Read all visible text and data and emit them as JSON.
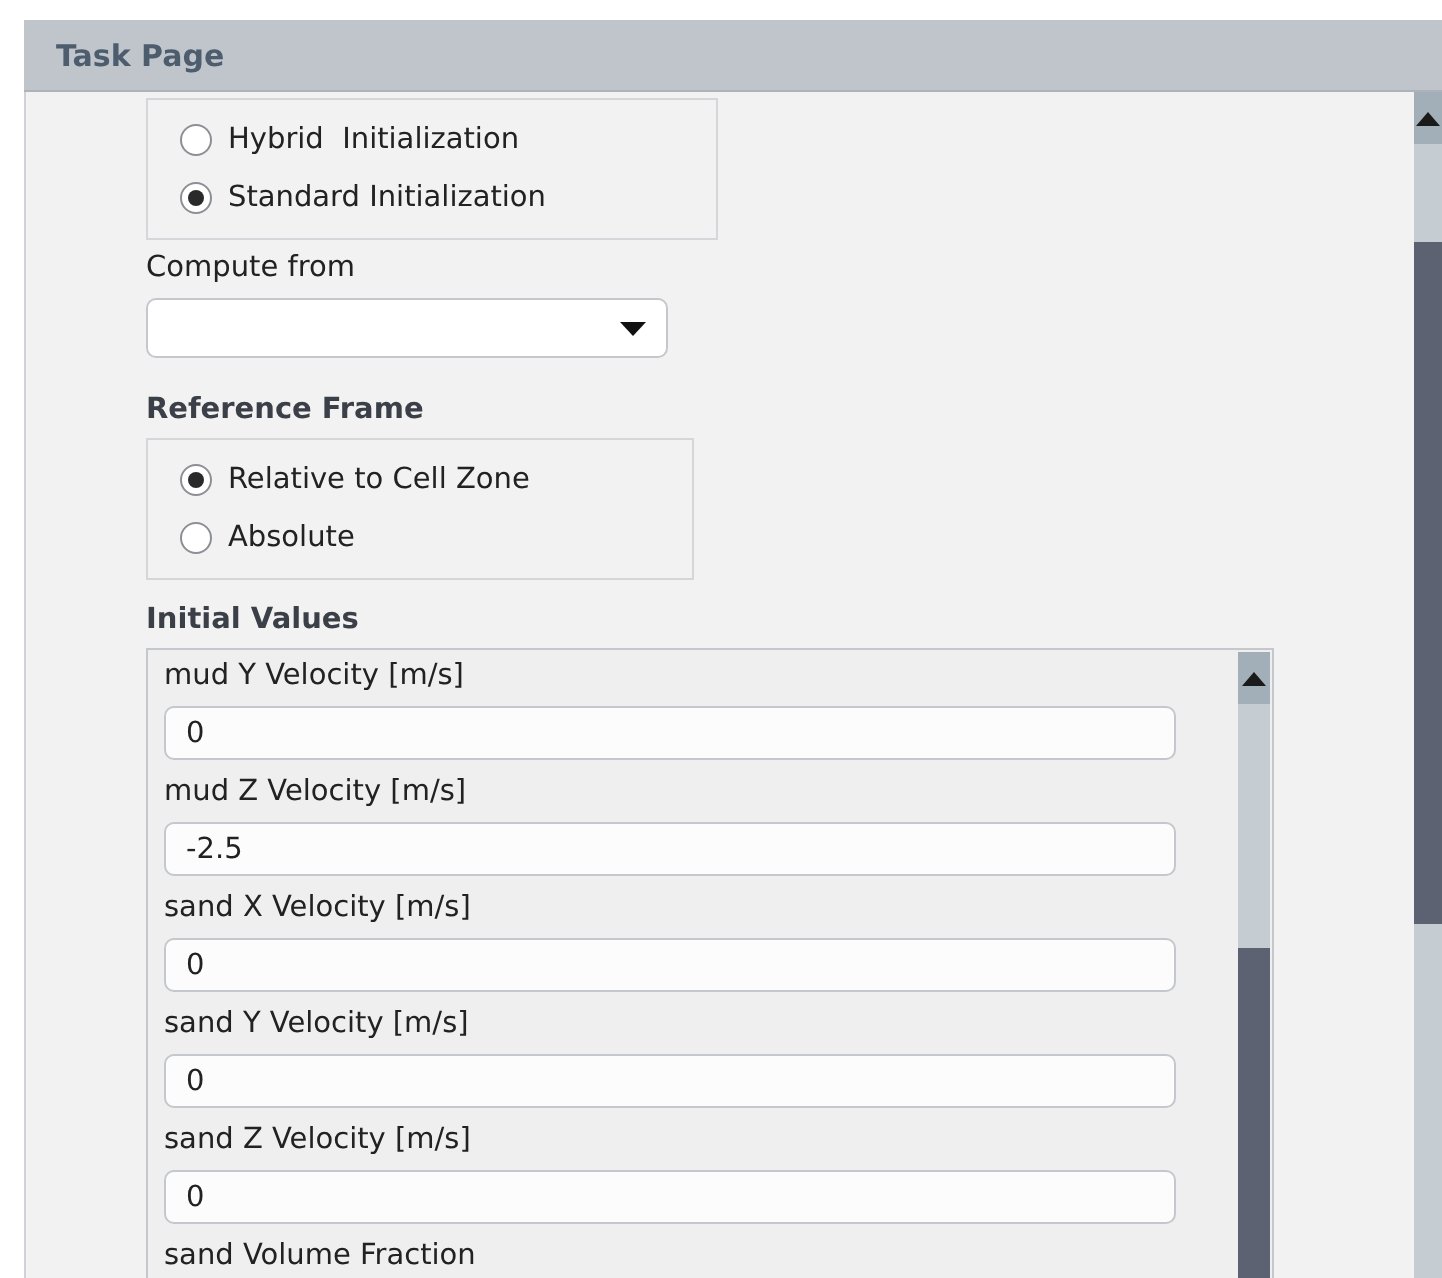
{
  "header": {
    "title": "Task Page"
  },
  "initialization": {
    "options": [
      {
        "label": "Hybrid  Initialization",
        "selected": false
      },
      {
        "label": "Standard Initialization",
        "selected": true
      }
    ]
  },
  "compute_from": {
    "label": "Compute from"
  },
  "reference_frame": {
    "title": "Reference Frame",
    "options": [
      {
        "label": "Relative to Cell Zone",
        "selected": true
      },
      {
        "label": "Absolute",
        "selected": false
      }
    ]
  },
  "initial_values": {
    "title": "Initial Values",
    "fields": [
      {
        "label": "mud Y Velocity [m/s]",
        "value": "0"
      },
      {
        "label": "mud Z Velocity [m/s]",
        "value": "-2.5"
      },
      {
        "label": "sand X Velocity [m/s]",
        "value": "0"
      },
      {
        "label": "sand Y Velocity [m/s]",
        "value": "0"
      },
      {
        "label": "sand Z Velocity [m/s]",
        "value": "0"
      },
      {
        "label": "sand Volume Fraction"
      }
    ]
  }
}
